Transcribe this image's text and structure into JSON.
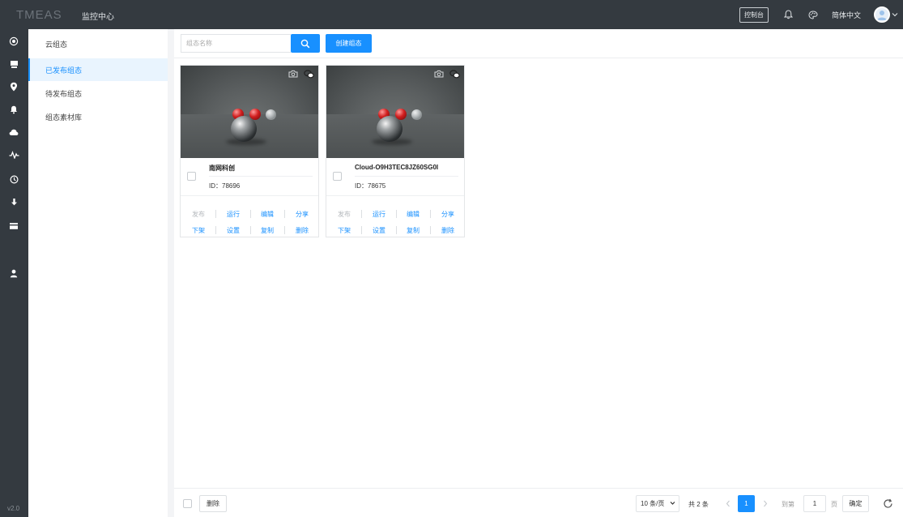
{
  "header": {
    "logo": "TMEAS",
    "title": "监控中心",
    "console_label": "控制台",
    "language": "简体中文",
    "icons": [
      "bell-icon",
      "palette-icon",
      "user-avatar",
      "chevron-down-icon"
    ]
  },
  "leftbar": {
    "icons": [
      "target-icon",
      "server-icon",
      "location-icon",
      "bell-icon",
      "cloud-icon",
      "pulse-icon",
      "clock-icon",
      "download-icon",
      "card-icon",
      "user-icon"
    ],
    "active": "cloud-icon",
    "version": "v2.0"
  },
  "sidemenu": {
    "items": [
      {
        "label": "云组态"
      },
      {
        "label": "已发布组态"
      },
      {
        "label": "待发布组态"
      },
      {
        "label": "组态素材库"
      }
    ],
    "active_index": 1
  },
  "toolbar": {
    "search_placeholder": "组态名称",
    "create_label": "创建组态"
  },
  "cards": [
    {
      "name": "南网科创",
      "id_label": "ID：",
      "id": "78696",
      "actions": [
        {
          "label": "发布",
          "disabled": true
        },
        {
          "label": "运行"
        },
        {
          "label": "编辑"
        },
        {
          "label": "分享"
        },
        {
          "label": "下架"
        },
        {
          "label": "设置"
        },
        {
          "label": "复制"
        },
        {
          "label": "删除"
        }
      ]
    },
    {
      "name": "Cloud-O9H3TEC8JZ60SG0I",
      "id_label": "ID：",
      "id": "78675",
      "actions": [
        {
          "label": "发布",
          "disabled": true
        },
        {
          "label": "运行"
        },
        {
          "label": "编辑"
        },
        {
          "label": "分享"
        },
        {
          "label": "下架"
        },
        {
          "label": "设置"
        },
        {
          "label": "复制"
        },
        {
          "label": "删除"
        }
      ]
    }
  ],
  "footer": {
    "delete_label": "删除",
    "page_size": "10 条/页",
    "total": "共 2 条",
    "current_page": "1",
    "goto_label": "到第",
    "goto_value": "1",
    "page_suffix": "页",
    "confirm_label": "确定"
  },
  "colors": {
    "accent": "#1890ff",
    "topbar": "#343a40",
    "active_bg": "#e9f4fe"
  }
}
